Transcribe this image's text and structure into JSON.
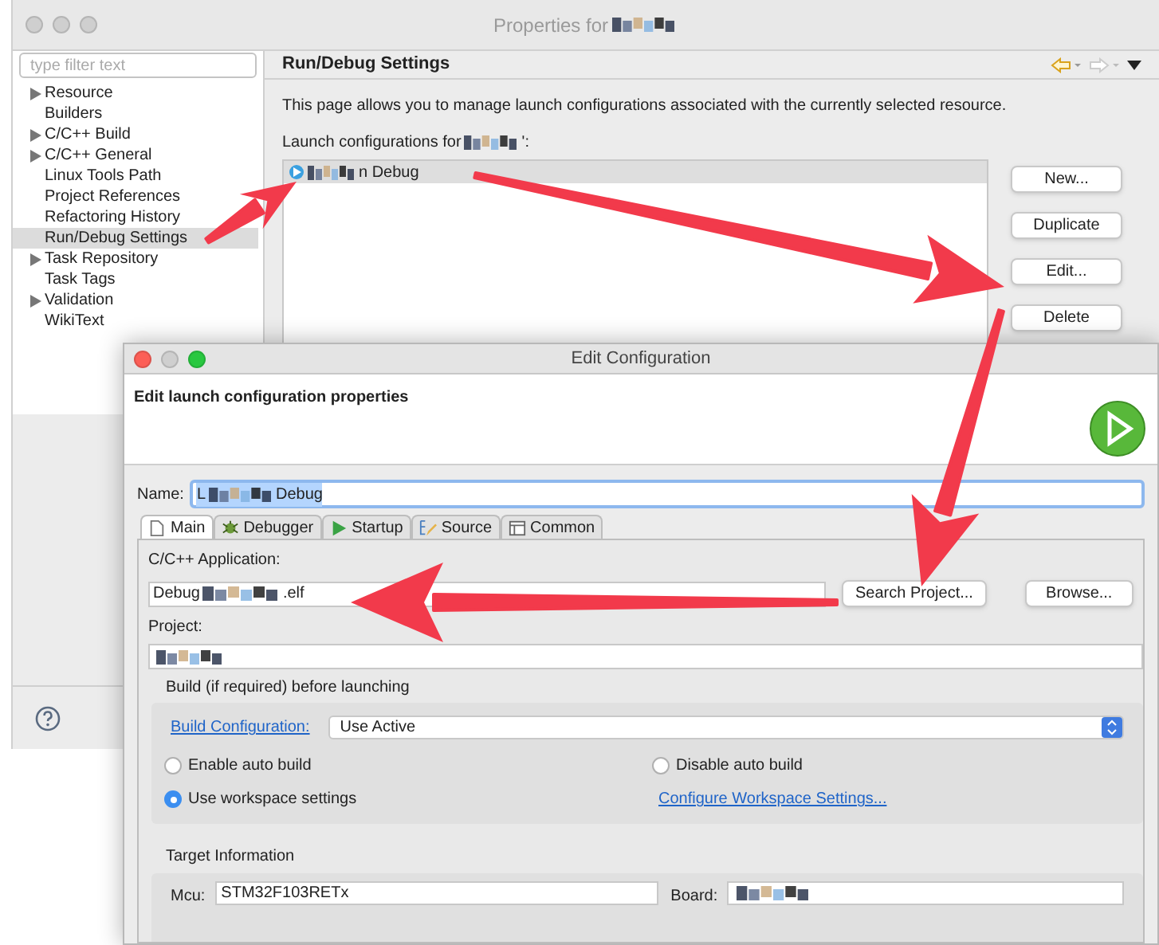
{
  "properties_window": {
    "title": "Properties for",
    "filter": {
      "placeholder": "type filter text"
    },
    "tree": [
      {
        "label": "Resource",
        "expandable": true,
        "selected": false
      },
      {
        "label": "Builders",
        "expandable": false,
        "selected": false
      },
      {
        "label": "C/C++ Build",
        "expandable": true,
        "selected": false
      },
      {
        "label": "C/C++ General",
        "expandable": true,
        "selected": false
      },
      {
        "label": "Linux Tools Path",
        "expandable": false,
        "selected": false
      },
      {
        "label": "Project References",
        "expandable": false,
        "selected": false
      },
      {
        "label": "Refactoring History",
        "expandable": false,
        "selected": false
      },
      {
        "label": "Run/Debug Settings",
        "expandable": false,
        "selected": true
      },
      {
        "label": "Task Repository",
        "expandable": true,
        "selected": false
      },
      {
        "label": "Task Tags",
        "expandable": false,
        "selected": false
      },
      {
        "label": "Validation",
        "expandable": true,
        "selected": false
      },
      {
        "label": "WikiText",
        "expandable": false,
        "selected": false
      }
    ],
    "page_title": "Run/Debug Settings",
    "description": "This page allows you to manage launch configurations associated with the currently selected resource.",
    "list_label": "Launch configurations for",
    "list_label_end": "':",
    "configurations": [
      {
        "label": "n Debug",
        "selected": true
      }
    ],
    "buttons": [
      "New...",
      "Duplicate",
      "Edit...",
      "Delete"
    ]
  },
  "edit_dialog": {
    "title": "Edit Configuration",
    "heading": "Edit launch configuration properties",
    "name": {
      "label": "Name:",
      "value_start": "L",
      "value_end": "Debug"
    },
    "tabs": [
      {
        "label": "Main",
        "selected": true
      },
      {
        "label": "Debugger",
        "selected": false
      },
      {
        "label": "Startup",
        "selected": false
      },
      {
        "label": "Source",
        "selected": false
      },
      {
        "label": "Common",
        "selected": false
      }
    ],
    "application": {
      "label": "C/C++ Application:",
      "value_start": "Debug",
      "value_end": ".elf",
      "buttons": [
        "Search Project...",
        "Browse..."
      ]
    },
    "project": {
      "label": "Project:"
    },
    "build": {
      "label": "Build (if required) before launching",
      "config_link": "Build Configuration:",
      "config_value": "Use Active",
      "options": [
        {
          "label": "Enable auto build",
          "selected": false
        },
        {
          "label": "Disable auto build",
          "selected": false
        },
        {
          "label": "Use workspace settings",
          "selected": true
        }
      ],
      "workspace_link": "Configure Workspace Settings..."
    },
    "target": {
      "label": "Target Information",
      "mcu_label": "Mcu:",
      "mcu_value": "STM32F103RETx",
      "board_label": "Board:"
    }
  }
}
